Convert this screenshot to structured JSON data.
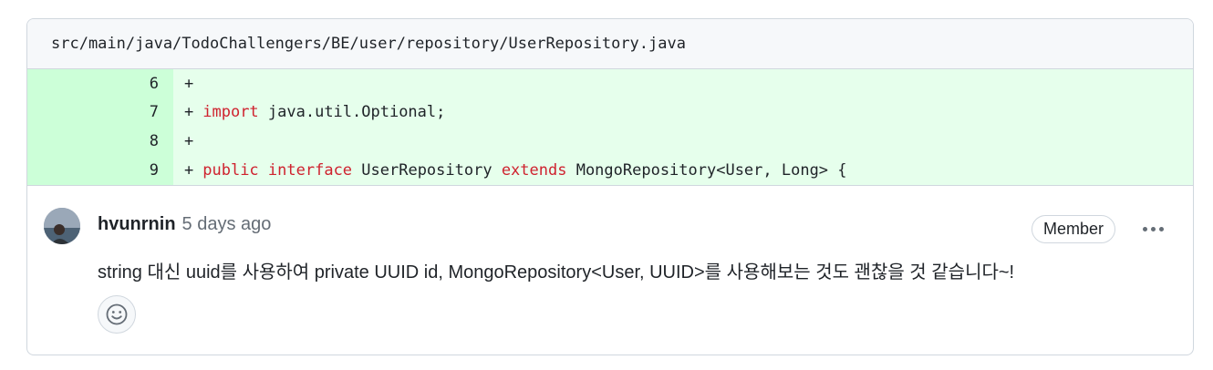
{
  "file": {
    "path": "src/main/java/TodoChallengers/BE/user/repository/UserRepository.java"
  },
  "diff": {
    "lines": [
      {
        "num": "6",
        "plus": "+",
        "segments": []
      },
      {
        "num": "7",
        "plus": "+",
        "segments": [
          {
            "kind": "kw",
            "text": "import"
          },
          {
            "kind": "tx",
            "text": " java.util.Optional;"
          }
        ]
      },
      {
        "num": "8",
        "plus": "+",
        "segments": []
      },
      {
        "num": "9",
        "plus": "+",
        "segments": [
          {
            "kind": "kw",
            "text": "public"
          },
          {
            "kind": "tx",
            "text": " "
          },
          {
            "kind": "kw",
            "text": "interface"
          },
          {
            "kind": "tx",
            "text": " UserRepository "
          },
          {
            "kind": "kw",
            "text": "extends"
          },
          {
            "kind": "tx",
            "text": " MongoRepository<User, Long> {"
          }
        ]
      }
    ]
  },
  "comment": {
    "author": "hvunrnin",
    "time": "5 days ago",
    "badge": "Member",
    "body": "string 대신 uuid를 사용하여 private UUID id, MongoRepository<User, UUID>를 사용해보는 것도 괜찮을 것 같습니다~!",
    "menu_icon": "kebab-horizontal-icon",
    "reaction_icon": "smiley-icon"
  },
  "colors": {
    "keyword": "#cf222e",
    "added_bg": "#e6ffec",
    "added_num_bg": "#ccffd8",
    "border": "#d0d7de",
    "muted": "#656d76"
  }
}
